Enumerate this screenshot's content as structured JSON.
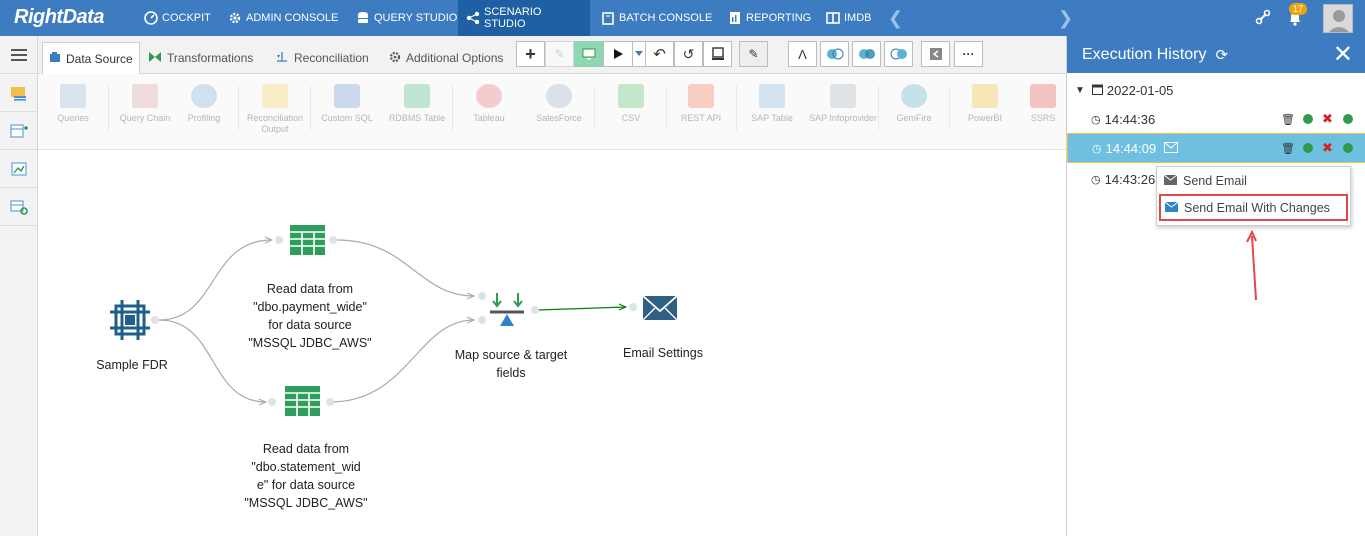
{
  "brand": {
    "logo_text": "RightData"
  },
  "nav": {
    "items": [
      {
        "label": "COCKPIT",
        "icon": "gauge-icon"
      },
      {
        "label": "ADMIN CONSOLE",
        "icon": "gear-icon"
      },
      {
        "label": "QUERY STUDIO",
        "icon": "database-icon"
      },
      {
        "label": "SCENARIO STUDIO",
        "icon": "flow-icon",
        "active": true
      },
      {
        "label": "BATCH CONSOLE",
        "icon": "batch-icon"
      },
      {
        "label": "REPORTING",
        "icon": "report-icon"
      },
      {
        "label": "IMDB",
        "icon": "columns-icon"
      }
    ],
    "notification_count": "17"
  },
  "tabs": [
    {
      "label": "Data Source",
      "icon": "datasource-icon",
      "active": true
    },
    {
      "label": "Transformations",
      "icon": "bowtie-icon"
    },
    {
      "label": "Reconciliation",
      "icon": "scale-icon"
    },
    {
      "label": "Additional Options",
      "icon": "gear-icon"
    }
  ],
  "palette": [
    {
      "label": "Queries",
      "color": "#9bb6d3"
    },
    {
      "label": "Query Chain",
      "color": "#d6a3a3"
    },
    {
      "label": "Profiling",
      "color": "#7fb0d8"
    },
    {
      "label": "Reconciliation Output",
      "color": "#f0d36a"
    },
    {
      "label": "Custom SQL",
      "color": "#6f9ed2"
    },
    {
      "label": "RDBMS Table",
      "color": "#59b98a"
    },
    {
      "label": "Tableau",
      "color": "#e7737a"
    },
    {
      "label": "SalesForce",
      "color": "#9fb3c8"
    },
    {
      "label": "CSV",
      "color": "#5fbf6e"
    },
    {
      "label": "REST API",
      "color": "#f07a55"
    },
    {
      "label": "SAP Table",
      "color": "#8db7de"
    },
    {
      "label": "SAP Infoprovider",
      "color": "#a9b6c4"
    },
    {
      "label": "GemFire",
      "color": "#63b3c9"
    },
    {
      "label": "PowerBI",
      "color": "#f2c33c"
    },
    {
      "label": "SSRS",
      "color": "#e95a5a"
    }
  ],
  "flow": {
    "node_source": "Sample FDR",
    "node_read1": [
      "Read data from",
      "\"dbo.payment_wide\"",
      "for data source",
      "\"MSSQL JDBC_AWS\""
    ],
    "node_read2": [
      "Read data from",
      "\"dbo.statement_wid",
      "e\" for data source",
      "\"MSSQL JDBC_AWS\""
    ],
    "node_map": [
      "Map source & target",
      "fields"
    ],
    "node_email": "Email Settings"
  },
  "history": {
    "title": "Execution History",
    "date": "2022-01-05",
    "runs": [
      "14:44:36",
      "14:44:09",
      "14:43:26"
    ],
    "menu": {
      "send_email": "Send Email",
      "send_email_changes": "Send Email With Changes"
    }
  }
}
